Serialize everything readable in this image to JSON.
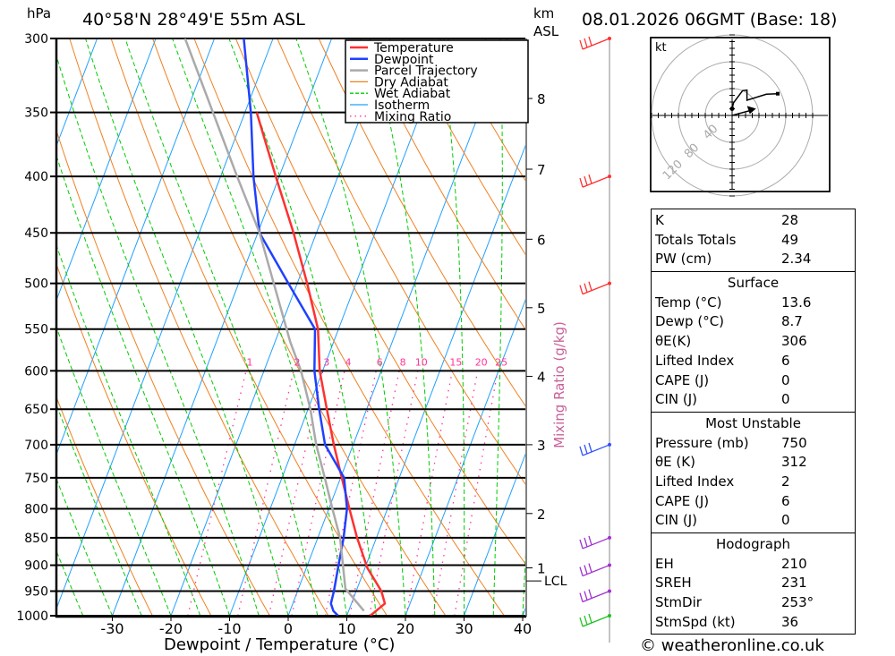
{
  "header": {
    "pressure_unit": "hPa",
    "location": "40°58'N 28°49'E 55m ASL",
    "km_label": "km",
    "asl_label": "ASL",
    "datetime": "08.01.2026 06GMT (Base: 18)"
  },
  "chart_data": {
    "type": "line",
    "subtype": "skew-T log-P",
    "xlabel": "Dewpoint / Temperature (°C)",
    "x_ticks": [
      -30,
      -20,
      -10,
      0,
      10,
      20,
      30,
      40
    ],
    "xlim": [
      -40,
      40
    ],
    "pressure_ticks": [
      300,
      350,
      400,
      450,
      500,
      550,
      600,
      650,
      700,
      750,
      800,
      850,
      900,
      950,
      1000
    ],
    "ylim_hpa": [
      1000,
      300
    ],
    "y_scale": "log",
    "legend": {
      "placement": "top-right",
      "entries": [
        {
          "label": "Temperature",
          "color": "#ff3030",
          "style": "solid"
        },
        {
          "label": "Dewpoint",
          "color": "#2040ff",
          "style": "solid"
        },
        {
          "label": "Parcel Trajectory",
          "color": "#aaaaaa",
          "style": "solid"
        },
        {
          "label": "Dry Adiabat",
          "color": "#f08020",
          "style": "solid"
        },
        {
          "label": "Wet Adiabat",
          "color": "#00cc00",
          "style": "dashed"
        },
        {
          "label": "Isotherm",
          "color": "#20a0ff",
          "style": "solid"
        },
        {
          "label": "Mixing Ratio",
          "color": "#ff3399",
          "style": "dotted"
        }
      ]
    },
    "series": [
      {
        "name": "Temperature",
        "color": "#ff3030",
        "p": [
          1000,
          975,
          950,
          905,
          850,
          800,
          750,
          700,
          650,
          600,
          550,
          500,
          450,
          400,
          350
        ],
        "t": [
          14.0,
          15.7,
          14.3,
          10.4,
          6.7,
          3.5,
          0.2,
          -3.3,
          -6.8,
          -10.5,
          -13.5,
          -18.3,
          -23.9,
          -30.6,
          -38.0
        ]
      },
      {
        "name": "Dewpoint",
        "color": "#2040ff",
        "p": [
          1000,
          990,
          975,
          950,
          905,
          850,
          800,
          750,
          700,
          650,
          600,
          550,
          500,
          450,
          400,
          350,
          300
        ],
        "t": [
          8.5,
          7.4,
          6.5,
          6.2,
          5.4,
          4.4,
          3.1,
          0.6,
          -4.8,
          -8.1,
          -11.4,
          -14.0,
          -21.5,
          -29.7,
          -34.4,
          -39.0,
          -45.0
        ]
      },
      {
        "name": "Parcel Trajectory",
        "color": "#aaaaaa",
        "p": [
          990,
          945,
          850,
          800,
          750,
          700,
          650,
          600,
          565,
          500,
          450,
          400,
          300
        ],
        "t": [
          12.6,
          8.0,
          3.8,
          0.6,
          -2.7,
          -6.3,
          -9.6,
          -13.7,
          -17.4,
          -24.0,
          -29.7,
          -37.2,
          -55.0
        ]
      }
    ],
    "isotherms_step_c": 10,
    "dry_adiabat_step_k": 10,
    "wet_adiabat_step_c": 5,
    "mixing_ratio": {
      "label": "Mixing Ratio (g/kg)",
      "values": [
        1,
        2,
        3,
        4,
        6,
        8,
        10,
        15,
        20,
        25
      ],
      "labels": [
        "1",
        "2",
        "3",
        "4",
        "6",
        "8",
        "10",
        "15",
        "20",
        "25"
      ],
      "top_hpa": 600
    },
    "km_axis": {
      "ticks": [
        {
          "label": "1",
          "p": 905
        },
        {
          "label": "2",
          "p": 808
        },
        {
          "label": "3",
          "p": 700
        },
        {
          "label": "4",
          "p": 607
        },
        {
          "label": "5",
          "p": 526
        },
        {
          "label": "6",
          "p": 456
        },
        {
          "label": "7",
          "p": 394
        },
        {
          "label": "8",
          "p": 340
        }
      ],
      "lcl_label": "LCL",
      "lcl_p": 930
    },
    "wind_barbs": [
      {
        "p": 300,
        "color": "#ff3030"
      },
      {
        "p": 400,
        "color": "#ff3030"
      },
      {
        "p": 500,
        "color": "#ff3030"
      },
      {
        "p": 700,
        "color": "#3050ff"
      },
      {
        "p": 850,
        "color": "#a030d0"
      },
      {
        "p": 900,
        "color": "#a030d0"
      },
      {
        "p": 950,
        "color": "#a030d0"
      },
      {
        "p": 1000,
        "color": "#20c020"
      }
    ]
  },
  "hodograph": {
    "unit_label": "kt",
    "rings": [
      40,
      80,
      120
    ],
    "ring_labels": [
      "40",
      "80",
      "120"
    ],
    "trace_uv_kt": [
      [
        0,
        10
      ],
      [
        2.2,
        19
      ],
      [
        15.6,
        36.9
      ],
      [
        22.2,
        37.8
      ],
      [
        22.2,
        22.7
      ],
      [
        51,
        31.6
      ],
      [
        68,
        32.4
      ]
    ],
    "storm_motion_uv_kt": [
      35.6,
      10.2
    ]
  },
  "stats": {
    "indices": [
      {
        "label": "K",
        "value": "28"
      },
      {
        "label": "Totals Totals",
        "value": "49"
      },
      {
        "label": "PW (cm)",
        "value": "2.34"
      }
    ],
    "surface": {
      "title": "Surface",
      "rows": [
        {
          "label": "Temp (°C)",
          "value": "13.6"
        },
        {
          "label": "Dewp (°C)",
          "value": "8.7"
        },
        {
          "label": "θE(K)",
          "value": "306"
        },
        {
          "label": "Lifted Index",
          "value": "6"
        },
        {
          "label": "CAPE (J)",
          "value": "0"
        },
        {
          "label": "CIN (J)",
          "value": "0"
        }
      ]
    },
    "most_unstable": {
      "title": "Most Unstable",
      "rows": [
        {
          "label": "Pressure (mb)",
          "value": "750"
        },
        {
          "label": "θE (K)",
          "value": "312"
        },
        {
          "label": "Lifted Index",
          "value": "2"
        },
        {
          "label": "CAPE (J)",
          "value": "6"
        },
        {
          "label": "CIN (J)",
          "value": "0"
        }
      ]
    },
    "hodograph": {
      "title": "Hodograph",
      "rows": [
        {
          "label": "EH",
          "value": "210"
        },
        {
          "label": "SREH",
          "value": "231"
        },
        {
          "label": "StmDir",
          "value": "253°"
        },
        {
          "label": "StmSpd (kt)",
          "value": "36"
        }
      ]
    }
  },
  "footer": {
    "copyright": "© weatheronline.co.uk"
  }
}
